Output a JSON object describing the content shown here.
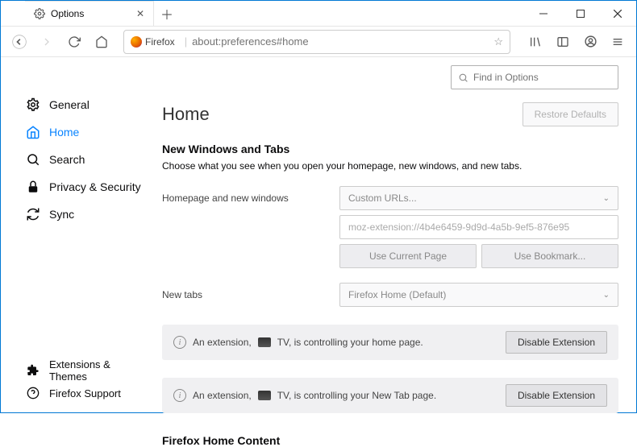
{
  "window": {
    "tab_title": "Options",
    "url_scheme": "Firefox",
    "url": "about:preferences#home"
  },
  "sidebar": {
    "items": [
      {
        "label": "General"
      },
      {
        "label": "Home"
      },
      {
        "label": "Search"
      },
      {
        "label": "Privacy & Security"
      },
      {
        "label": "Sync"
      }
    ],
    "bottom": [
      {
        "label": "Extensions & Themes"
      },
      {
        "label": "Firefox Support"
      }
    ]
  },
  "find": {
    "placeholder": "Find in Options"
  },
  "page": {
    "title": "Home",
    "restore": "Restore Defaults",
    "section": "New Windows and Tabs",
    "desc": "Choose what you see when you open your homepage, new windows, and new tabs.",
    "homepage_label": "Homepage and new windows",
    "homepage_select": "Custom URLs...",
    "homepage_url": "moz-extension://4b4e6459-9d9d-4a5b-9ef5-876e95",
    "use_current": "Use Current Page",
    "use_bookmark": "Use Bookmark...",
    "newtabs_label": "New tabs",
    "newtabs_select": "Firefox Home (Default)",
    "section2": "Firefox Home Content"
  },
  "warnings": {
    "home": {
      "pre": "An extension,",
      "ext": "TV",
      "post": ", is controlling your home page."
    },
    "newtab": {
      "pre": "An extension,",
      "ext": "TV",
      "post": ", is controlling your New Tab page."
    },
    "disable": "Disable Extension"
  }
}
